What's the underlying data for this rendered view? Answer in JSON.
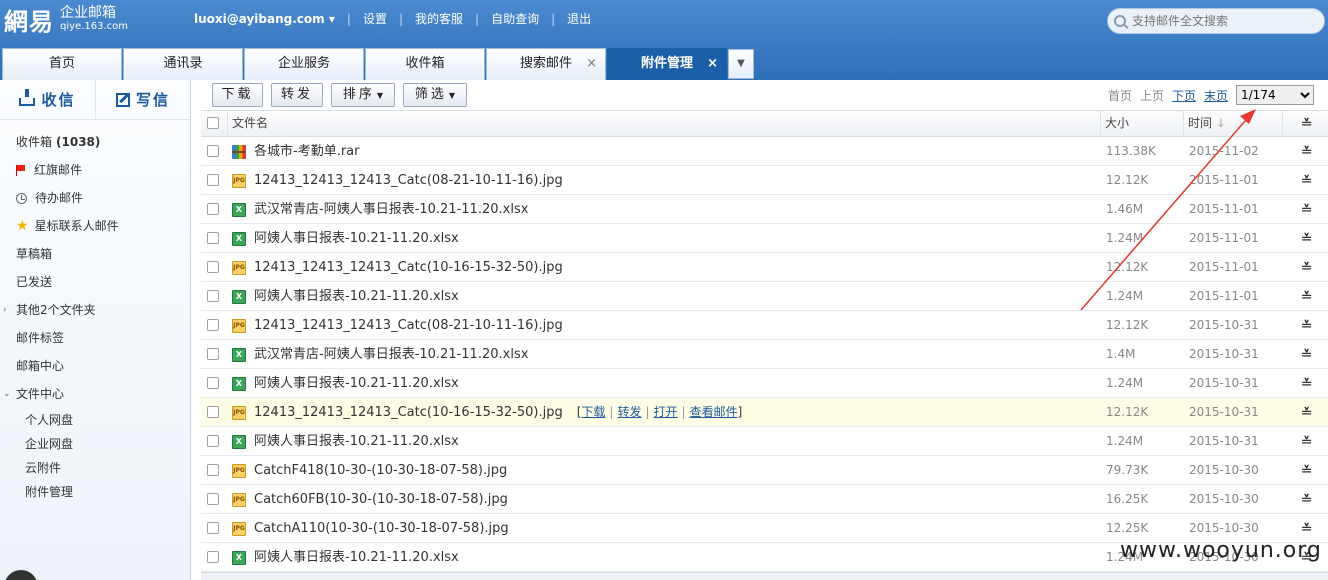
{
  "brand": {
    "logo_main": "網易",
    "logo_title": "企业邮箱",
    "logo_domain": "qiye.163.com"
  },
  "topnav": {
    "account": "luoxi@ayibang.com",
    "links": [
      "设置",
      "我的客服",
      "自助查询",
      "退出"
    ]
  },
  "search": {
    "placeholder": "支持邮件全文搜索"
  },
  "tabs": [
    {
      "label": "首页"
    },
    {
      "label": "通讯录"
    },
    {
      "label": "企业服务"
    },
    {
      "label": "收件箱"
    },
    {
      "label": "搜索邮件",
      "close": "×"
    },
    {
      "label": "附件管理",
      "close": "×",
      "active": true
    }
  ],
  "sidebar": {
    "receive": "收信",
    "compose": "写信",
    "inbox_label": "收件箱",
    "inbox_count": "(1038)",
    "items": [
      "红旗邮件",
      "待办邮件",
      "星标联系人邮件",
      "草稿箱",
      "已发送",
      "其他2个文件夹",
      "邮件标签",
      "邮箱中心",
      "文件中心"
    ],
    "sub_items": [
      "个人网盘",
      "企业网盘",
      "云附件",
      "附件管理"
    ]
  },
  "toolbar": {
    "download": "下载",
    "forward": "转发",
    "sort": "排序",
    "filter": "筛选",
    "pager": {
      "first": "首页",
      "prev": "上页",
      "next": "下页",
      "last": "末页",
      "page": "1/174"
    }
  },
  "table": {
    "columns": {
      "name": "文件名",
      "size": "大小",
      "time": "时间"
    },
    "row_actions": {
      "download": "下载",
      "forward": "转发",
      "open": "打开",
      "view": "查看邮件"
    },
    "rows": [
      {
        "type": "rar",
        "name": "各城市-考勤单.rar",
        "size": "113.38K",
        "date": "2015-11-02"
      },
      {
        "type": "jpg",
        "name": "12413_12413_12413_Catc(08-21-10-11-16).jpg",
        "size": "12.12K",
        "date": "2015-11-01"
      },
      {
        "type": "xls",
        "name": "武汉常青店-阿姨人事日报表-10.21-11.20.xlsx",
        "size": "1.46M",
        "date": "2015-11-01"
      },
      {
        "type": "xls",
        "name": "阿姨人事日报表-10.21-11.20.xlsx",
        "size": "1.24M",
        "date": "2015-11-01"
      },
      {
        "type": "jpg",
        "name": "12413_12413_12413_Catc(10-16-15-32-50).jpg",
        "size": "12.12K",
        "date": "2015-11-01"
      },
      {
        "type": "xls",
        "name": "阿姨人事日报表-10.21-11.20.xlsx",
        "size": "1.24M",
        "date": "2015-11-01"
      },
      {
        "type": "jpg",
        "name": "12413_12413_12413_Catc(08-21-10-11-16).jpg",
        "size": "12.12K",
        "date": "2015-10-31"
      },
      {
        "type": "xls",
        "name": "武汉常青店-阿姨人事日报表-10.21-11.20.xlsx",
        "size": "1.4M",
        "date": "2015-10-31"
      },
      {
        "type": "xls",
        "name": "阿姨人事日报表-10.21-11.20.xlsx",
        "size": "1.24M",
        "date": "2015-10-31"
      },
      {
        "type": "jpg",
        "name": "12413_12413_12413_Catc(10-16-15-32-50).jpg",
        "size": "12.12K",
        "date": "2015-10-31",
        "hover": true
      },
      {
        "type": "xls",
        "name": "阿姨人事日报表-10.21-11.20.xlsx",
        "size": "1.24M",
        "date": "2015-10-31"
      },
      {
        "type": "jpg",
        "name": "CatchF418(10-30-(10-30-18-07-58).jpg",
        "size": "79.73K",
        "date": "2015-10-30"
      },
      {
        "type": "jpg",
        "name": "Catch60FB(10-30-(10-30-18-07-58).jpg",
        "size": "16.25K",
        "date": "2015-10-30"
      },
      {
        "type": "jpg",
        "name": "CatchA110(10-30-(10-30-18-07-58).jpg",
        "size": "12.25K",
        "date": "2015-10-30"
      },
      {
        "type": "xls",
        "name": "阿姨人事日报表-10.21-11.20.xlsx",
        "size": "1.24M",
        "date": "2015-10-30"
      }
    ]
  },
  "watermark": "www.wooyun.org",
  "colors": {
    "header": "#2f6fb7",
    "active_tab": "#1b5fa8",
    "link": "#1d5a9d",
    "annotation": "#e53a2f",
    "hover_row": "#fdfde6"
  }
}
